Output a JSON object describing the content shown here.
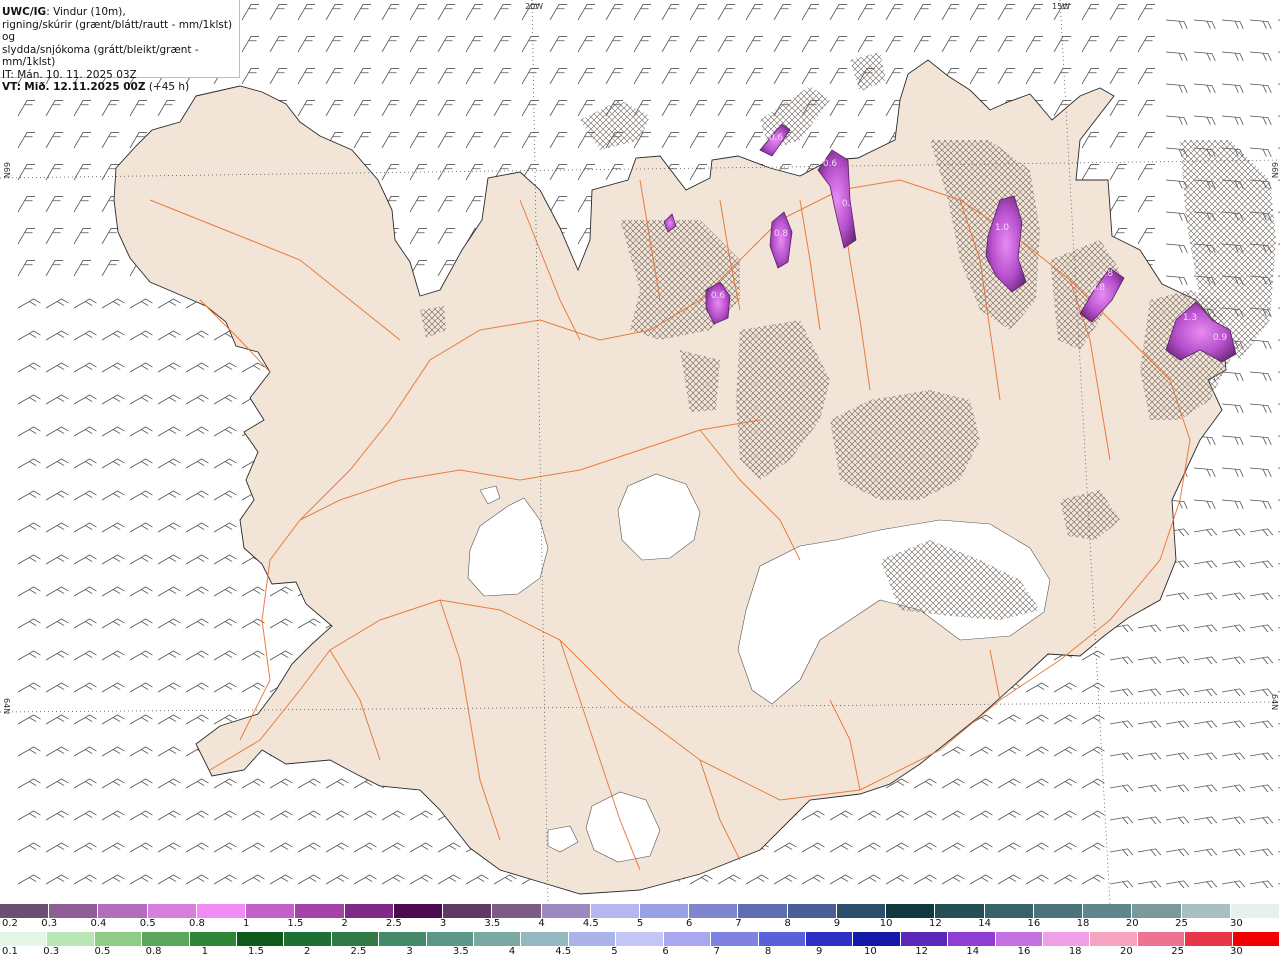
{
  "header": {
    "model": "UWC/IG",
    "line1": ": Vindur (10m),",
    "line2": "rigning/skúrir (grænt/blátt/rautt - mm/1klst) og",
    "line3": "slydda/snjókoma (grátt/bleikt/grænt - mm/1klst)",
    "issue_time": "IT: Mán. 10. 11. 2025 03Z",
    "valid_prefix": "VT:",
    "valid_time": "Mið. 12.11.2025 00Z",
    "lead": "(+45 h)"
  },
  "grid_labels": {
    "lon_20w": "20W",
    "lon_15w": "15W",
    "lat_66n_left": "66N",
    "lat_66n_right": "66N",
    "lat_64n_left": "64N",
    "lat_64n_right": "64N"
  },
  "precip_labels": [
    {
      "label": "0.6"
    },
    {
      "label": "0.6"
    },
    {
      "label": "0.7"
    },
    {
      "label": "0.8"
    },
    {
      "label": "0.6"
    },
    {
      "label": "1.0"
    },
    {
      "label": "0.8"
    },
    {
      "label": "0.8"
    },
    {
      "label": "1.3"
    },
    {
      "label": "0.9"
    }
  ],
  "snow_legend": {
    "labels": [
      "0.2",
      "0.3",
      "0.4",
      "0.5",
      "0.8",
      "1",
      "1.5",
      "2",
      "2.5",
      "3",
      "3.5",
      "4",
      "4.5",
      "5",
      "6",
      "7",
      "8",
      "9",
      "10",
      "12",
      "14",
      "16",
      "18",
      "20",
      "25",
      "30"
    ],
    "colors": [
      "#6b4f73",
      "#8e5f97",
      "#b36dbb",
      "#d77fdc",
      "#f08cf3",
      "#c461c9",
      "#a444a9",
      "#7f2b86",
      "#4c0a4f",
      "#5e3a64",
      "#7b5b82",
      "#9b89bf",
      "#b6b6f0",
      "#9aa0e4",
      "#7f86cf",
      "#5f6db3",
      "#4b5f97",
      "#2b4f68",
      "#10383e",
      "#234f55",
      "#376269",
      "#4a7479",
      "#5f878b",
      "#79999c",
      "#a9c0c0",
      "#e8f0ee"
    ]
  },
  "rain_legend": {
    "labels": [
      "0.1",
      "0.3",
      "0.5",
      "0.8",
      "1",
      "1.5",
      "2",
      "2.5",
      "3",
      "3.5",
      "4",
      "4.5",
      "5",
      "6",
      "7",
      "8",
      "9",
      "10",
      "12",
      "14",
      "16",
      "18",
      "20",
      "25",
      "30"
    ],
    "colors": [
      "#e4f7e4",
      "#b9e6b5",
      "#8fcd87",
      "#5ba65a",
      "#2d8536",
      "#0f5a1a",
      "#1e6f32",
      "#317a46",
      "#46886a",
      "#5c9688",
      "#7aa9a2",
      "#94b7c0",
      "#aab4e8",
      "#c4c6f5",
      "#a7a8ef",
      "#7f82e3",
      "#5b5fd9",
      "#2e2fc4",
      "#1418a8",
      "#5a28b8",
      "#8e3fd2",
      "#c370e2",
      "#ef9ee8",
      "#f6a4c2",
      "#ee7390",
      "#e8374a",
      "#f00000"
    ]
  },
  "colors": {
    "land": "#f2e5d8",
    "coast": "#2a2a2a",
    "roads": "#e8702f",
    "sleet_hatch": "#6d6259",
    "precip_purple": "#b445c8"
  }
}
